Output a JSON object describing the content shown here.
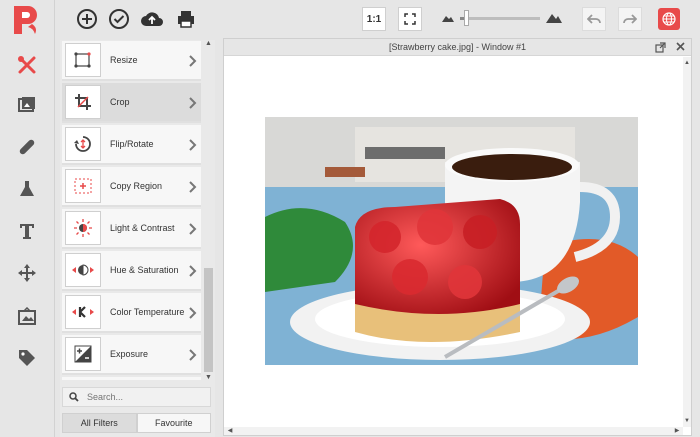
{
  "colors": {
    "brand": "#e84a4a",
    "rail_icon": "#555555",
    "active_rail_icon": "#e84a4a"
  },
  "rail": {
    "logo_letter": "P",
    "items": [
      "tools-icon",
      "gallery-icon",
      "bandage-icon",
      "flask-icon",
      "text-icon",
      "move-icon",
      "frame-icon",
      "tag-icon"
    ]
  },
  "toolbar": {
    "icons": [
      "add-circle-icon",
      "check-circle-icon",
      "cloud-upload-icon",
      "print-icon"
    ],
    "ratio_label": "1:1",
    "zoom_level": 0.05
  },
  "filters": {
    "items": [
      {
        "label": "Resize",
        "icon": "resize-icon"
      },
      {
        "label": "Crop",
        "icon": "crop-icon",
        "active": true
      },
      {
        "label": "Flip/Rotate",
        "icon": "rotate-icon"
      },
      {
        "label": "Copy Region",
        "icon": "copy-region-icon"
      },
      {
        "label": "Light & Contrast",
        "icon": "sun-icon"
      },
      {
        "label": "Hue & Saturation",
        "icon": "hue-icon"
      },
      {
        "label": "Color Temperature",
        "icon": "temperature-icon"
      },
      {
        "label": "Exposure",
        "icon": "exposure-icon"
      }
    ],
    "search_placeholder": "Search...",
    "tabs": [
      "All Filters",
      "Favourite"
    ]
  },
  "window": {
    "title": "[Strawberry cake.jpg] - Window #1"
  }
}
